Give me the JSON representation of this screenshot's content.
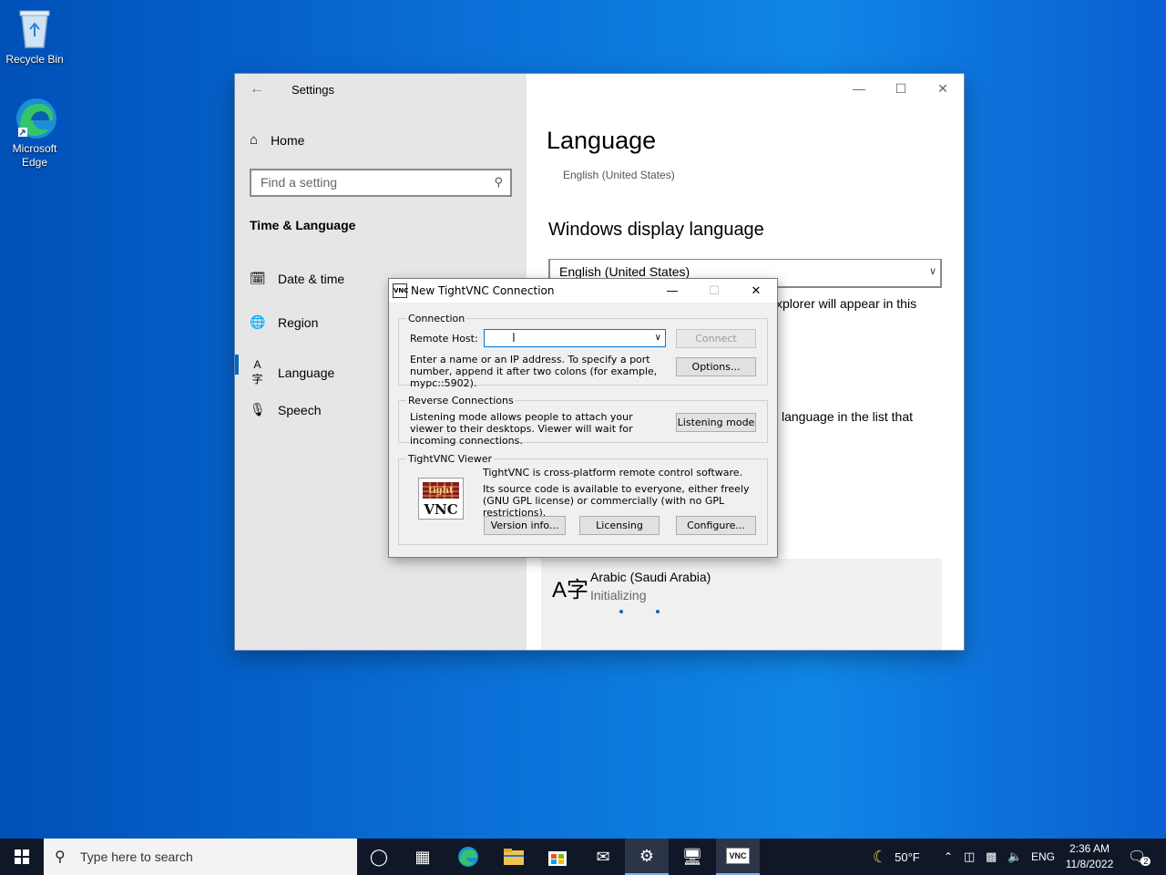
{
  "desktop": {
    "recycle_bin": "Recycle Bin",
    "edge": "Microsoft Edge"
  },
  "settings": {
    "title": "Settings",
    "home": "Home",
    "search_placeholder": "Find a setting",
    "section": "Time & Language",
    "nav": [
      {
        "label": "Date & time",
        "icon": "calendar-clock-icon"
      },
      {
        "label": "Region",
        "icon": "globe-icon"
      },
      {
        "label": "Language",
        "icon": "language-icon"
      },
      {
        "label": "Speech",
        "icon": "microphone-icon"
      }
    ],
    "active_nav": "Language",
    "page_title": "Language",
    "page_subtitle": "English (United States)",
    "display_heading": "Windows display language",
    "display_value": "English (United States)",
    "fragment_1": "xplorer will appear in this",
    "fragment_2": "language in the list that",
    "pending_language": "Arabic (Saudi Arabia)",
    "pending_status": "Initializing"
  },
  "vnc": {
    "title": "New TightVNC Connection",
    "connection_group": "Connection",
    "remote_host_label": "Remote Host:",
    "remote_host_value": "",
    "connect": "Connect",
    "hint": "Enter a name or an IP address. To specify a port number, append it after two colons (for example, mypc::5902).",
    "options": "Options...",
    "reverse_group": "Reverse Connections",
    "reverse_text": "Listening mode allows people to attach your viewer to their desktops. Viewer will wait for incoming connections.",
    "listening": "Listening mode",
    "viewer_group": "TightVNC Viewer",
    "viewer_text_1": "TightVNC is cross-platform remote control software.",
    "viewer_text_2": "Its source code is available to everyone, either freely (GNU GPL license) or commercially (with no GPL restrictions).",
    "version_info": "Version info...",
    "licensing": "Licensing",
    "configure": "Configure...",
    "logo_top": "tight",
    "logo_bottom": "VNC"
  },
  "taskbar": {
    "search_placeholder": "Type here to search",
    "weather": "50°F",
    "lang": "ENG",
    "time": "2:36 AM",
    "date": "11/8/2022",
    "notifications": "2"
  }
}
